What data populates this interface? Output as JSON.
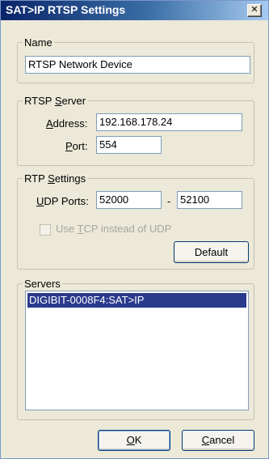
{
  "window": {
    "title": "SAT>IP RTSP Settings",
    "close_glyph": "✕"
  },
  "name_group": {
    "legend": "Name",
    "value": "RTSP Network Device"
  },
  "rtsp_server": {
    "legend_pre": "RTSP ",
    "legend_hot": "S",
    "legend_post": "erver",
    "address_hot": "A",
    "address_rest": "ddress:",
    "address_value": "192.168.178.24",
    "port_hot": "P",
    "port_rest": "ort:",
    "port_value": "554"
  },
  "rtp_settings": {
    "legend_pre": "RTP ",
    "legend_hot": "S",
    "legend_post": "ettings",
    "udp_hot": "U",
    "udp_rest": "DP Ports:",
    "udp_from": "52000",
    "dash": "-",
    "udp_to": "52100",
    "tcp_pre": "Use ",
    "tcp_hot": "T",
    "tcp_post": "CP instead of UDP",
    "tcp_checked": false,
    "default_label": "Default"
  },
  "servers": {
    "legend": "Servers",
    "items": [
      "DIGIBIT-0008F4:SAT>IP"
    ],
    "selected_index": 0
  },
  "buttons": {
    "ok_hot": "O",
    "ok_rest": "K",
    "cancel_hot": "C",
    "cancel_rest": "ancel"
  }
}
